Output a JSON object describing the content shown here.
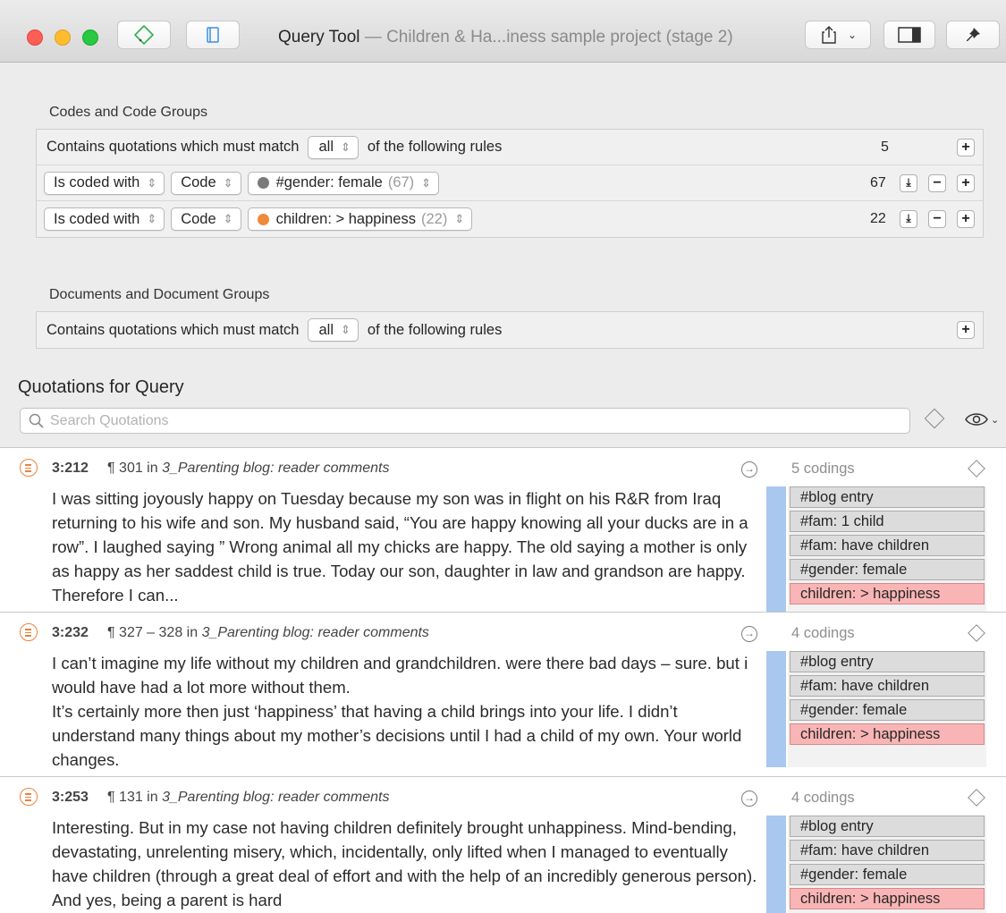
{
  "window": {
    "title_main": "Query Tool",
    "title_sub": " — Children & Ha...iness sample project (stage 2)"
  },
  "toolbar": {
    "traffic_lights": [
      "close",
      "minimize",
      "zoom"
    ],
    "left_buttons": [
      "code-tag-icon",
      "document-icon"
    ],
    "right_buttons": [
      "share-icon",
      "sidebar-icon",
      "pin-icon"
    ]
  },
  "codes_section": {
    "label": "Codes and Code Groups",
    "header": {
      "prefix": "Contains quotations which must match",
      "match": "all",
      "suffix": "of the following rules",
      "count": "5"
    },
    "rules": [
      {
        "operator": "Is coded with",
        "kind": "Code",
        "dot_color": "#7a7a7a",
        "code": "#gender: female",
        "code_count": "(67)",
        "count": "67"
      },
      {
        "operator": "Is coded with",
        "kind": "Code",
        "dot_color": "#f08a3a",
        "code": "children: > happiness",
        "code_count": "(22)",
        "count": "22"
      }
    ]
  },
  "documents_section": {
    "label": "Documents and Document Groups",
    "header": {
      "prefix": "Contains quotations which must match",
      "match": "all",
      "suffix": "of the following rules"
    }
  },
  "quotations": {
    "heading": "Quotations for Query",
    "search_placeholder": "Search Quotations",
    "items": [
      {
        "id": "3:212",
        "para_prefix": "¶ 301 in ",
        "doc": "3_Parenting blog: reader comments",
        "text": "I was sitting joyously happy on Tuesday because my son was in flight on his R&R from Iraq returning to his wife and son. My husband said, “You are happy knowing all your ducks are in a row”. I laughed saying ” Wrong animal all my chicks are happy. The old saying a mother is only as happy as her saddest child is true. Today our son, daughter in law and grandson are happy. Therefore I can...",
        "codings_label": "5 codings",
        "codes": [
          "#blog entry",
          "#fam: 1 child",
          "#fam: have children",
          "#gender: female",
          "children: > happiness"
        ]
      },
      {
        "id": "3:232",
        "para_prefix": "¶ 327 – 328 in ",
        "doc": "3_Parenting blog: reader comments",
        "text": "I can’t imagine my life without my children and grandchildren. were there bad days – sure. but i would have had a lot more without them.\nIt’s certainly more then just ‘happiness’ that having a child brings into your life. I didn’t understand many things about my mother’s decisions until I had a child of my own. Your world changes.",
        "codings_label": "4 codings",
        "codes": [
          "#blog entry",
          "#fam: have children",
          "#gender: female",
          "children: > happiness"
        ]
      },
      {
        "id": "3:253",
        "para_prefix": "¶ 131 in ",
        "doc": "3_Parenting blog: reader comments",
        "text": "Interesting. But in my case not having children definitely brought unhappiness. Mind-bending, devastating, unrelenting misery, which, incidentally, only lifted when I managed to eventually have children (through a great deal of effort and with the help of an incredibly generous person). And yes, being a parent is hard",
        "codings_label": "4 codings",
        "codes": [
          "#blog entry",
          "#fam: have children",
          "#gender: female",
          "children: > happiness"
        ]
      }
    ],
    "highlight_code": "children: > happiness",
    "colors": {
      "highlight_chip": "#f9b5b5",
      "quote_bar": "#a8c8ef",
      "quote_icon": "#e7833f"
    }
  }
}
